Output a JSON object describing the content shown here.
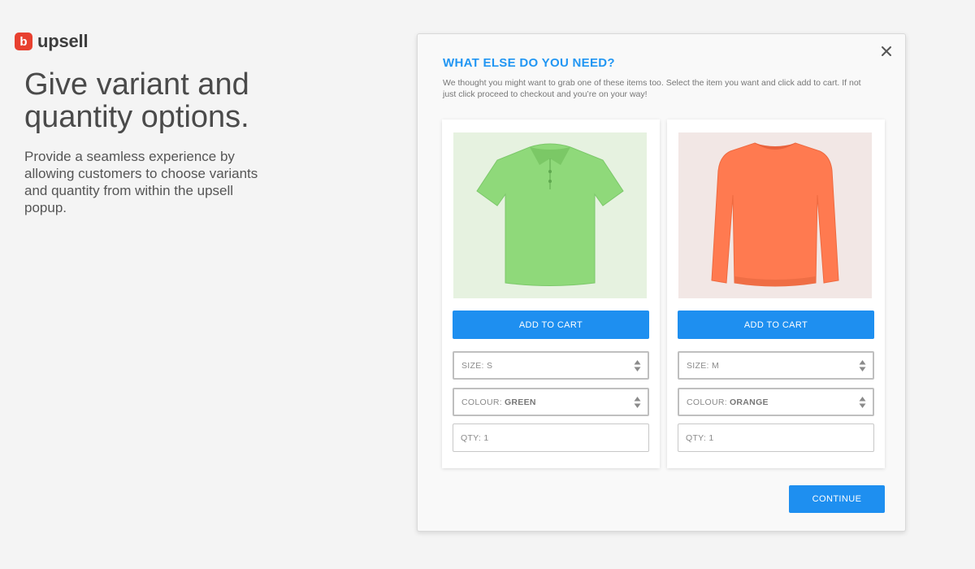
{
  "brand": {
    "mark": "b",
    "name": "upsell",
    "color": "#e8402f"
  },
  "hero": {
    "title": "Give variant and quantity options.",
    "body": "Provide a seamless experience by allowing customers to choose variants and quantity from within the upsell popup."
  },
  "popup": {
    "title": "WHAT ELSE DO YOU NEED?",
    "description": "We thought you might want to grab one of these items too. Select the item you want and click add to cart. If not just click proceed to checkout and you’re on your way!",
    "close_icon": "close-icon",
    "accent_color": "#2196f3",
    "button_color": "#1e8ff0",
    "continue_label": "CONTINUE",
    "products": [
      {
        "image": "green-polo-shirt",
        "add_label": "ADD TO CART",
        "size_label": "SIZE: S",
        "colour_prefix": "COLOUR:",
        "colour_value": "GREEN",
        "qty_placeholder": "QTY: 1"
      },
      {
        "image": "orange-sweatshirt",
        "add_label": "ADD TO CART",
        "size_label": "SIZE: M",
        "colour_prefix": "COLOUR:",
        "colour_value": "ORANGE",
        "qty_placeholder": "QTY: 1"
      }
    ]
  }
}
